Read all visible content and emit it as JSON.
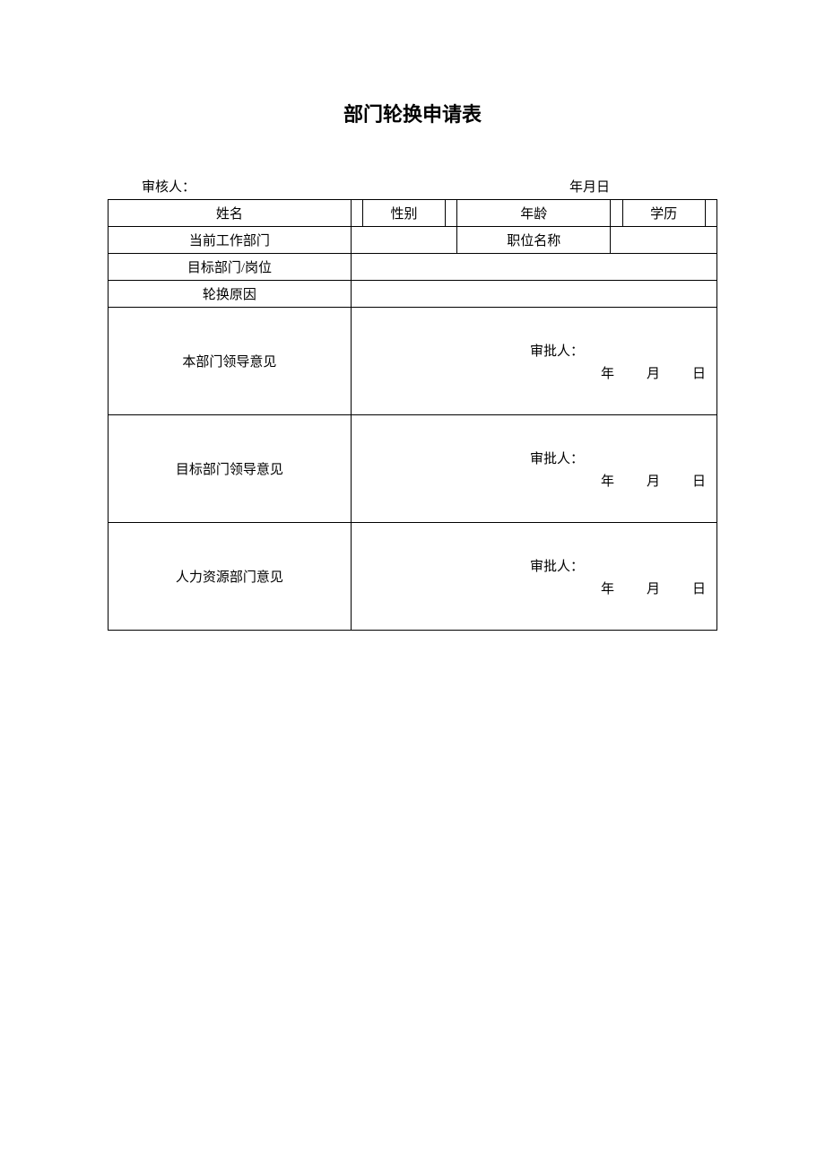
{
  "title": "部门轮换申请表",
  "header": {
    "reviewer_label": "审核人：",
    "date_label": "年月日"
  },
  "labels": {
    "name": "姓名",
    "gender": "性别",
    "age": "年龄",
    "education": "学历",
    "current_dept": "当前工作部门",
    "position": "职位名称",
    "target_dept": "目标部门/岗位",
    "reason": "轮换原因",
    "own_dept_opinion": "本部门领导意见",
    "target_dept_opinion": "目标部门领导意见",
    "hr_opinion": "人力资源部门意见",
    "approver": "审批人：",
    "year": "年",
    "month": "月",
    "day": "日"
  },
  "values": {
    "name": "",
    "gender": "",
    "age": "",
    "education": "",
    "current_dept": "",
    "position": "",
    "target_dept": "",
    "reason": ""
  }
}
